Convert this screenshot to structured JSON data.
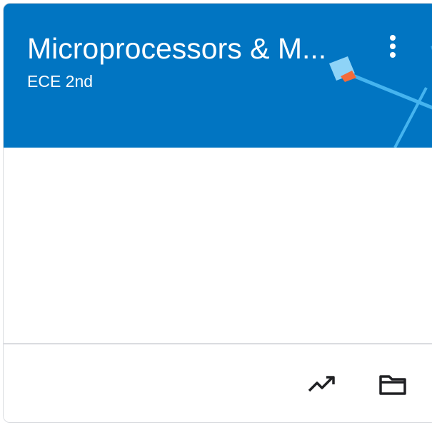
{
  "course_card": {
    "title": "Microprocessors & M...",
    "section": "ECE 2nd",
    "header_color": "#0175c2",
    "menu_icon": "more-vert-icon",
    "footer": {
      "actions": [
        {
          "icon": "trending-up-icon"
        },
        {
          "icon": "folder-icon"
        }
      ]
    }
  }
}
